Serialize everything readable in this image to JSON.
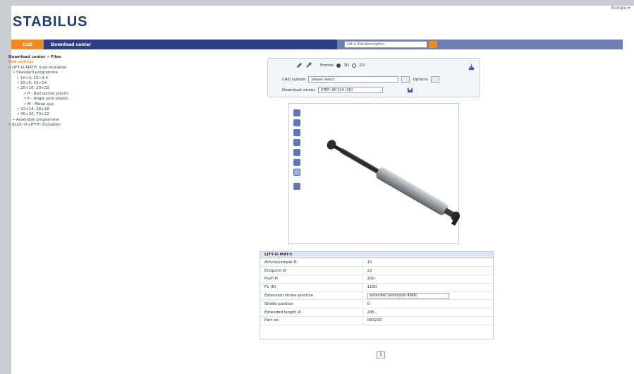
{
  "header": {
    "logo": "STABILUS",
    "language": "Europe ▾"
  },
  "nav": {
    "tabs": [
      {
        "label": "CAD"
      },
      {
        "label": "Download center"
      }
    ],
    "search_value": "Lift-o-Mat/description"
  },
  "sidebar": {
    "title": "Download center » Files",
    "link": "Grid settings",
    "items": [
      "• LIFT-O-MAT® (non-lockable)",
      "  • Standard programme",
      "    • 10+4, 15+4 4",
      "    • 15+6, 15+14",
      "    • 20+10, 20+22",
      "      • P - Ball socket plastic",
      "      • P - Angle joint plastic",
      "      • M - Metal eye",
      "    • 22+14, 28+28",
      "    • 40+20, 70+22",
      "  • Assemble programme",
      "• BLOC-O-LIFT® (lockable)"
    ]
  },
  "toolbar": {
    "format_label": "Format",
    "format_options": [
      "3D",
      "2D"
    ],
    "cad_system_label": "CAD system",
    "cad_system_value": "please select",
    "options_label": "Options",
    "download_label": "Download center",
    "download_value": "STEP, AP 214 (3D)"
  },
  "properties": {
    "title": "LIFT-O-MAT®",
    "rows": [
      {
        "key": "Article/sample Ø",
        "value": "10"
      },
      {
        "key": "Endpoint Ø",
        "value": "22"
      },
      {
        "key": "Push N",
        "value": "200"
      },
      {
        "key": "F1 (N)",
        "value": "1150"
      },
      {
        "key": "Extension stroke position",
        "value": "extended (extension 49kb)"
      },
      {
        "key": "Stroke position",
        "value": "0"
      },
      {
        "key": "Extended length Ø",
        "value": "285"
      },
      {
        "key": "Part no.",
        "value": "083232"
      }
    ]
  },
  "pager": {
    "label": "1"
  }
}
